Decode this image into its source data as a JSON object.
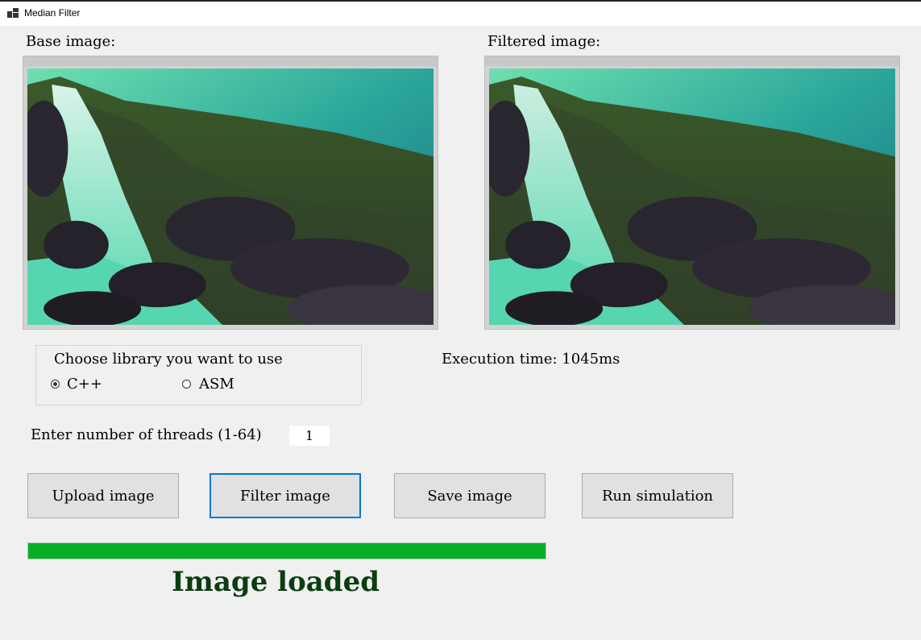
{
  "window": {
    "title": "Median Filter"
  },
  "images": {
    "base_label": "Base image:",
    "filtered_label": "Filtered image:"
  },
  "library": {
    "title": "Choose library you want to use",
    "options": [
      {
        "label": "C++",
        "selected": true
      },
      {
        "label": "ASM",
        "selected": false
      }
    ]
  },
  "execution": {
    "text": "Execution time: 1045ms"
  },
  "threads": {
    "label": "Enter number of threads (1-64)",
    "value": "1"
  },
  "buttons": {
    "upload": "Upload image",
    "filter": "Filter image",
    "save": "Save image",
    "simulate": "Run simulation"
  },
  "progress": {
    "value": 1.0,
    "color": "#06b025"
  },
  "status": {
    "text": "Image loaded",
    "color": "#0a3d10"
  }
}
